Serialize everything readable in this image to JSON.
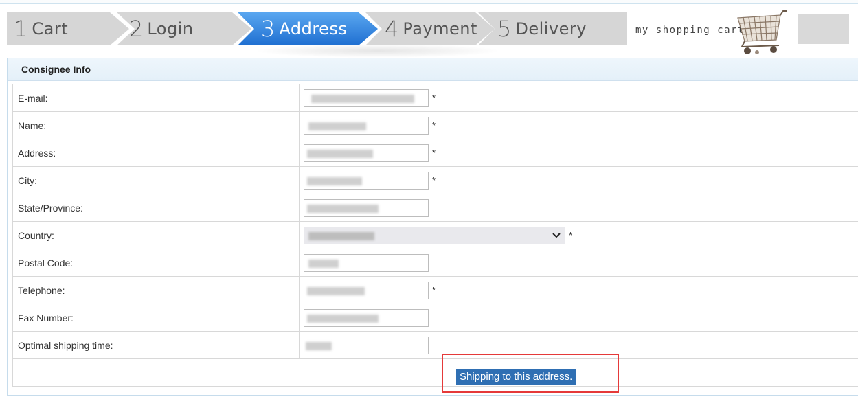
{
  "steps": [
    {
      "num": "1",
      "label": "Cart",
      "active": false
    },
    {
      "num": "2",
      "label": "Login",
      "active": false
    },
    {
      "num": "3",
      "label": "Address",
      "active": true
    },
    {
      "num": "4",
      "label": "Payment",
      "active": false
    },
    {
      "num": "5",
      "label": "Delivery",
      "active": false
    }
  ],
  "cart": {
    "label": "my shopping cart",
    "icon": "shopping-cart-icon"
  },
  "panel": {
    "title": "Consignee Info"
  },
  "fields": {
    "email": {
      "label": "E-mail:",
      "required": "*"
    },
    "name": {
      "label": "Name:",
      "required": "*"
    },
    "address": {
      "label": "Address:",
      "required": "*"
    },
    "city": {
      "label": "City:",
      "required": "*"
    },
    "state": {
      "label": "State/Province:"
    },
    "country": {
      "label": "Country:",
      "required": "*"
    },
    "postal": {
      "label": "Postal Code:"
    },
    "telephone": {
      "label": "Telephone:",
      "required": "*"
    },
    "fax": {
      "label": "Fax Number:"
    },
    "shipping_time": {
      "label": "Optimal shipping time:"
    }
  },
  "actions": {
    "ship_label": "Shipping to this address."
  },
  "colors": {
    "active_step": "#2f86e0",
    "inactive_step": "#d6d6d6",
    "button": "#2f6fb3",
    "highlight": "#e53a3a"
  }
}
